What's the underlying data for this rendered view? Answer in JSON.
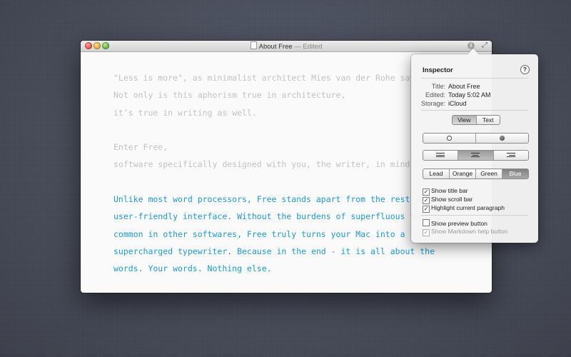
{
  "window": {
    "doc_name": "About Free",
    "status": "— Edited"
  },
  "editor": {
    "lines": [
      "\"Less is more\", as minimalist architect Mies van der Rohe says.",
      "Not only is this aphorism true in architecture,",
      "it’s true in writing as well.",
      "",
      "Enter Free,",
      "software specifically designed with you, the writer, in mind.",
      "",
      "Unlike most word processors, Free stands apart from the rest with",
      "user-friendly interface. Without the burdens of superfluous features",
      "common in other softwares, Free truly turns your Mac into a",
      "supercharged typewriter. Because in the end - it is all about the",
      "words. Your words. Nothing else."
    ],
    "highlight_color": "#1e9ad6",
    "dim_color": "#c2c2c2"
  },
  "inspector": {
    "title": "Inspector",
    "help": "?",
    "meta": {
      "title_key": "Title:",
      "title_val": "About Free",
      "edited_key": "Edited:",
      "edited_val": "Today 5:02 AM",
      "storage_key": "Storage:",
      "storage_val": "iCloud"
    },
    "tabs": [
      "View",
      "Text"
    ],
    "selected_tab": "View",
    "colors": [
      "Lead",
      "Orange",
      "Green",
      "Blue"
    ],
    "selected_color": "Blue",
    "checkboxes": [
      {
        "label": "Show title bar",
        "checked": true
      },
      {
        "label": "Show scroll bar",
        "checked": true
      },
      {
        "label": "Highlight current paragraph",
        "checked": true
      },
      {
        "label": "Show preview button",
        "checked": false
      },
      {
        "label": "Show Markdown help button",
        "checked": true
      }
    ]
  }
}
